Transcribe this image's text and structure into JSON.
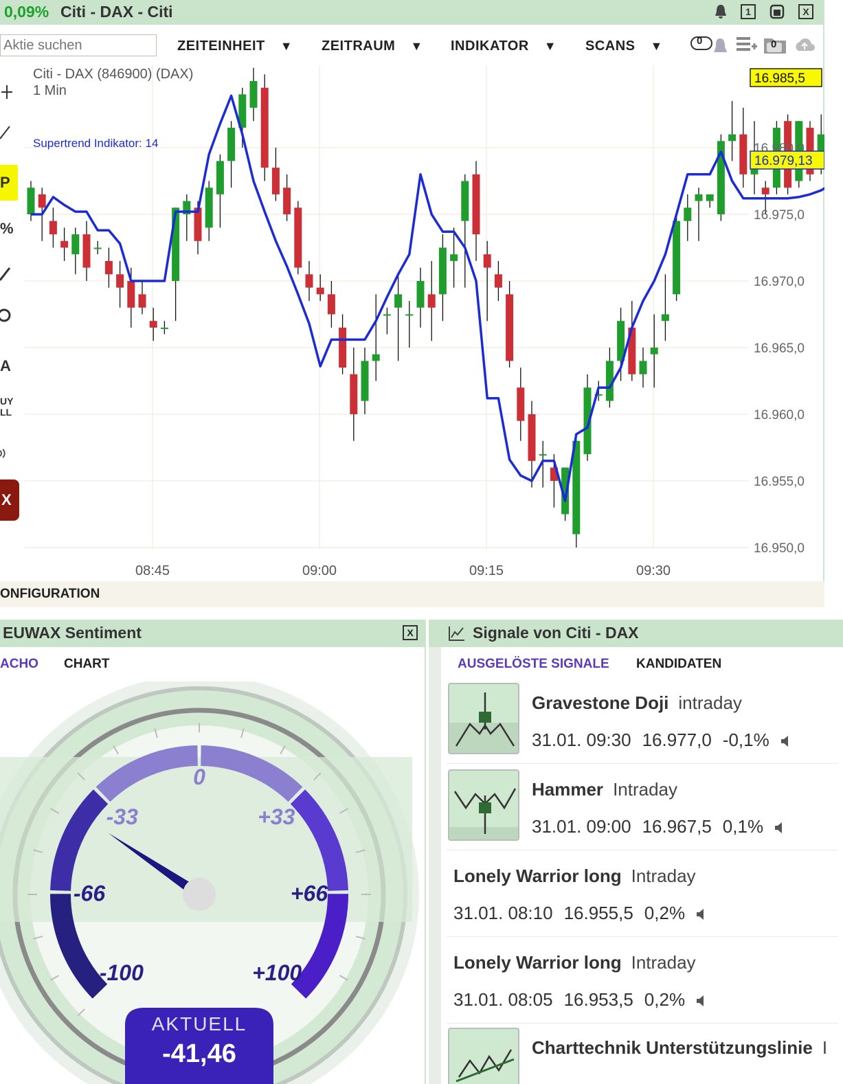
{
  "window": {
    "change": "0,09%",
    "title": "Citi - DAX - Citi",
    "btn_one": "1",
    "btn_close": "X"
  },
  "toolbar": {
    "search_placeholder": "Aktie suchen",
    "menu": [
      "ZEITEINHEIT",
      "ZEITRAUM",
      "INDIKATOR",
      "SCANS"
    ],
    "caret": "▼",
    "alert_count": "0",
    "watch_count": "0"
  },
  "left_tools": {
    "p": "P",
    "pct": "%",
    "a": "A",
    "buy": "UY",
    "sell": "LL",
    "x": "X"
  },
  "chart": {
    "instrument": "Citi - DAX (846900) (DAX)",
    "interval": "1 Min",
    "indicator": "Supertrend Indikator: 14",
    "price_badge_last": "16.985,5",
    "price_badge_trend": "16.979,13",
    "config_label": "ONFIGURATION",
    "colors": {
      "up": "#1f9e2e",
      "down": "#cc2f35",
      "trend": "#1b2bd6",
      "badge": "#f8f800"
    }
  },
  "chart_data": {
    "type": "candlestick",
    "title": "Citi - DAX (846900) (DAX)",
    "interval": "1 Min",
    "y_ticks": [
      "16.950,0",
      "16.955,0",
      "16.960,0",
      "16.965,0",
      "16.970,0",
      "16.975,0",
      "16.980,0"
    ],
    "x_ticks": [
      "08:45",
      "09:00",
      "09:15",
      "09:30"
    ],
    "ylim": [
      16949,
      16990
    ],
    "candles": [
      {
        "o": 16975.0,
        "h": 16977.5,
        "l": 16974.5,
        "c": 16977.0
      },
      {
        "o": 16976.5,
        "h": 16977.0,
        "l": 16973.0,
        "c": 16975.5
      },
      {
        "o": 16974.5,
        "h": 16975.5,
        "l": 16972.5,
        "c": 16973.5
      },
      {
        "o": 16973.0,
        "h": 16974.0,
        "l": 16971.5,
        "c": 16972.5
      },
      {
        "o": 16972.0,
        "h": 16974.0,
        "l": 16970.5,
        "c": 16973.5
      },
      {
        "o": 16973.5,
        "h": 16974.5,
        "l": 16970.0,
        "c": 16971.0
      },
      {
        "o": 16972.5,
        "h": 16973.0,
        "l": 16972.0,
        "c": 16972.5
      },
      {
        "o": 16971.5,
        "h": 16972.5,
        "l": 16969.5,
        "c": 16970.5
      },
      {
        "o": 16970.5,
        "h": 16971.5,
        "l": 16968.0,
        "c": 16969.5
      },
      {
        "o": 16970.0,
        "h": 16971.0,
        "l": 16966.5,
        "c": 16968.0
      },
      {
        "o": 16969.0,
        "h": 16970.0,
        "l": 16967.5,
        "c": 16968.0
      },
      {
        "o": 16967.0,
        "h": 16968.0,
        "l": 16965.5,
        "c": 16966.5
      },
      {
        "o": 16966.5,
        "h": 16967.0,
        "l": 16966.0,
        "c": 16966.5
      },
      {
        "o": 16970.0,
        "h": 16975.5,
        "l": 16967.0,
        "c": 16975.5
      },
      {
        "o": 16975.0,
        "h": 16976.5,
        "l": 16973.0,
        "c": 16976.0
      },
      {
        "o": 16975.5,
        "h": 16976.0,
        "l": 16972.0,
        "c": 16973.0
      },
      {
        "o": 16974.0,
        "h": 16977.5,
        "l": 16973.0,
        "c": 16977.0
      },
      {
        "o": 16976.5,
        "h": 16979.5,
        "l": 16974.0,
        "c": 16979.0
      },
      {
        "o": 16979.0,
        "h": 16982.0,
        "l": 16977.0,
        "c": 16981.5
      },
      {
        "o": 16981.5,
        "h": 16984.5,
        "l": 16980.0,
        "c": 16984.0
      },
      {
        "o": 16983.0,
        "h": 16986.0,
        "l": 16982.0,
        "c": 16985.0
      },
      {
        "o": 16984.5,
        "h": 16985.5,
        "l": 16977.5,
        "c": 16978.5
      },
      {
        "o": 16978.5,
        "h": 16980.0,
        "l": 16976.0,
        "c": 16976.5
      },
      {
        "o": 16977.0,
        "h": 16978.0,
        "l": 16974.5,
        "c": 16975.0
      },
      {
        "o": 16975.5,
        "h": 16976.0,
        "l": 16970.5,
        "c": 16971.0
      },
      {
        "o": 16970.5,
        "h": 16971.5,
        "l": 16968.5,
        "c": 16969.5
      },
      {
        "o": 16969.5,
        "h": 16970.5,
        "l": 16968.5,
        "c": 16969.0
      },
      {
        "o": 16969.0,
        "h": 16970.0,
        "l": 16966.5,
        "c": 16967.5
      },
      {
        "o": 16966.5,
        "h": 16967.5,
        "l": 16963.0,
        "c": 16963.5
      },
      {
        "o": 16963.0,
        "h": 16965.0,
        "l": 16958.0,
        "c": 16960.0
      },
      {
        "o": 16961.0,
        "h": 16965.0,
        "l": 16960.0,
        "c": 16964.0
      },
      {
        "o": 16964.0,
        "h": 16969.0,
        "l": 16962.5,
        "c": 16964.5
      },
      {
        "o": 16967.5,
        "h": 16968.0,
        "l": 16966.0,
        "c": 16967.5
      },
      {
        "o": 16968.0,
        "h": 16970.5,
        "l": 16964.0,
        "c": 16969.0
      },
      {
        "o": 16967.5,
        "h": 16968.5,
        "l": 16965.0,
        "c": 16967.5
      },
      {
        "o": 16968.0,
        "h": 16971.0,
        "l": 16966.5,
        "c": 16970.0
      },
      {
        "o": 16969.0,
        "h": 16971.5,
        "l": 16965.5,
        "c": 16968.0
      },
      {
        "o": 16969.0,
        "h": 16973.5,
        "l": 16967.0,
        "c": 16972.5
      },
      {
        "o": 16971.5,
        "h": 16974.0,
        "l": 16969.5,
        "c": 16972.0
      },
      {
        "o": 16974.5,
        "h": 16978.0,
        "l": 16969.5,
        "c": 16977.5
      },
      {
        "o": 16978.0,
        "h": 16979.0,
        "l": 16971.5,
        "c": 16973.5
      },
      {
        "o": 16972.0,
        "h": 16973.0,
        "l": 16967.0,
        "c": 16971.0
      },
      {
        "o": 16970.5,
        "h": 16971.5,
        "l": 16968.5,
        "c": 16969.5
      },
      {
        "o": 16969.0,
        "h": 16970.0,
        "l": 16963.5,
        "c": 16964.0
      },
      {
        "o": 16962.0,
        "h": 16963.5,
        "l": 16958.0,
        "c": 16959.5
      },
      {
        "o": 16960.0,
        "h": 16961.0,
        "l": 16954.5,
        "c": 16956.5
      },
      {
        "o": 16957.0,
        "h": 16958.0,
        "l": 16954.5,
        "c": 16957.0
      },
      {
        "o": 16956.0,
        "h": 16957.0,
        "l": 16953.0,
        "c": 16955.0
      },
      {
        "o": 16952.5,
        "h": 16956.0,
        "l": 16952.0,
        "c": 16956.0
      },
      {
        "o": 16951.0,
        "h": 16958.5,
        "l": 16950.0,
        "c": 16958.0
      },
      {
        "o": 16957.0,
        "h": 16963.0,
        "l": 16956.5,
        "c": 16962.0
      },
      {
        "o": 16961.5,
        "h": 16962.5,
        "l": 16961.0,
        "c": 16961.5
      },
      {
        "o": 16961.0,
        "h": 16965.0,
        "l": 16960.5,
        "c": 16964.0
      },
      {
        "o": 16964.0,
        "h": 16968.0,
        "l": 16962.5,
        "c": 16967.0
      },
      {
        "o": 16966.5,
        "h": 16968.5,
        "l": 16962.5,
        "c": 16963.0
      },
      {
        "o": 16963.0,
        "h": 16965.0,
        "l": 16962.0,
        "c": 16964.0
      },
      {
        "o": 16964.5,
        "h": 16967.5,
        "l": 16962.0,
        "c": 16965.0
      },
      {
        "o": 16967.0,
        "h": 16970.5,
        "l": 16965.5,
        "c": 16967.5
      },
      {
        "o": 16969.0,
        "h": 16975.0,
        "l": 16968.5,
        "c": 16974.5
      },
      {
        "o": 16974.5,
        "h": 16976.5,
        "l": 16973.0,
        "c": 16975.5
      },
      {
        "o": 16976.0,
        "h": 16977.0,
        "l": 16973.0,
        "c": 16976.5
      },
      {
        "o": 16976.0,
        "h": 16976.5,
        "l": 16975.5,
        "c": 16976.5
      },
      {
        "o": 16975.0,
        "h": 16981.0,
        "l": 16974.5,
        "c": 16980.5
      },
      {
        "o": 16980.5,
        "h": 16983.5,
        "l": 16979.0,
        "c": 16981.0
      },
      {
        "o": 16981.0,
        "h": 16983.0,
        "l": 16977.0,
        "c": 16978.0
      },
      {
        "o": 16978.0,
        "h": 16982.0,
        "l": 16976.5,
        "c": 16978.5
      },
      {
        "o": 16977.0,
        "h": 16977.5,
        "l": 16975.0,
        "c": 16976.5
      },
      {
        "o": 16977.0,
        "h": 16982.0,
        "l": 16976.5,
        "c": 16981.5
      },
      {
        "o": 16982.0,
        "h": 16982.5,
        "l": 16976.5,
        "c": 16977.0
      },
      {
        "o": 16977.5,
        "h": 16982.0,
        "l": 16977.0,
        "c": 16982.0
      },
      {
        "o": 16981.5,
        "h": 16982.0,
        "l": 16977.5,
        "c": 16978.0
      },
      {
        "o": 16979.0,
        "h": 16982.5,
        "l": 16978.0,
        "c": 16981.0
      },
      {
        "o": 16981.0,
        "h": 16983.5,
        "l": 16979.5,
        "c": 16980.0
      },
      {
        "o": 16982.0,
        "h": 16983.0,
        "l": 16979.5,
        "c": 16980.5
      },
      {
        "o": 16980.0,
        "h": 16983.5,
        "l": 16978.0,
        "c": 16980.0
      },
      {
        "o": 16980.5,
        "h": 16985.5,
        "l": 16979.5,
        "c": 16985.5
      }
    ],
    "series": [
      {
        "name": "Supertrend Indikator: 14",
        "values": [
          16975.0,
          16975.0,
          16976.3,
          16975.7,
          16975.2,
          16975.2,
          16973.8,
          16973.8,
          16972.8,
          16970.0,
          16970.0,
          16970.0,
          16970.0,
          16975.2,
          16975.2,
          16975.2,
          16979.5,
          16981.8,
          16983.9,
          16981.0,
          16977.5,
          16975.2,
          16973.0,
          16971.1,
          16969.0,
          16966.8,
          16963.6,
          16965.6,
          16965.6,
          16965.6,
          16965.6,
          16967.0,
          16968.8,
          16970.5,
          16972.0,
          16978.0,
          16975.0,
          16973.7,
          16973.7,
          16972.5,
          16970.0,
          16961.2,
          16961.2,
          16956.6,
          16955.4,
          16955.0,
          16956.5,
          16956.5,
          16953.5,
          16958.5,
          16959.0,
          16962.0,
          16962.0,
          16963.5,
          16966.5,
          16968.5,
          16970.0,
          16972.0,
          16975.0,
          16978.0,
          16978.0,
          16978.0,
          16979.7,
          16977.5,
          16976.2,
          16976.2,
          16976.2,
          16976.2,
          16976.2,
          16976.3,
          16976.5,
          16976.8,
          16977.3,
          16977.8,
          16978.2,
          16979.1
        ]
      }
    ]
  },
  "sentiment": {
    "title": "EUWAX Sentiment",
    "close": "X",
    "tabs": [
      "ACHO",
      "CHART"
    ],
    "scale_labels": [
      "-100",
      "-66",
      "-33",
      "0",
      "+33",
      "+66",
      "+100"
    ],
    "current_label": "AKTUELL",
    "current_value": "-41,46",
    "value": -41.46
  },
  "signals": {
    "title": "Signale von Citi - DAX",
    "tabs": [
      "AUSGELÖSTE SIGNALE",
      "KANDIDATEN"
    ],
    "items": [
      {
        "name": "Gravestone Doji",
        "freq": "intraday",
        "date": "31.01. 09:30",
        "price": "16.977,0",
        "change": "-0,1%",
        "thumb": "gravestone-doji"
      },
      {
        "name": "Hammer",
        "freq": "Intraday",
        "date": "31.01. 09:00",
        "price": "16.967,5",
        "change": "0,1%",
        "thumb": "hammer"
      },
      {
        "name": "Lonely Warrior long",
        "freq": "Intraday",
        "date": "31.01. 08:10",
        "price": "16.955,5",
        "change": "0,2%",
        "thumb": ""
      },
      {
        "name": "Lonely Warrior long",
        "freq": "Intraday",
        "date": "31.01. 08:05",
        "price": "16.953,5",
        "change": "0,2%",
        "thumb": ""
      },
      {
        "name": "Charttechnik Unterstützungslinie",
        "freq": "I",
        "date": "",
        "price": "",
        "change": "",
        "thumb": "support-line"
      }
    ]
  }
}
